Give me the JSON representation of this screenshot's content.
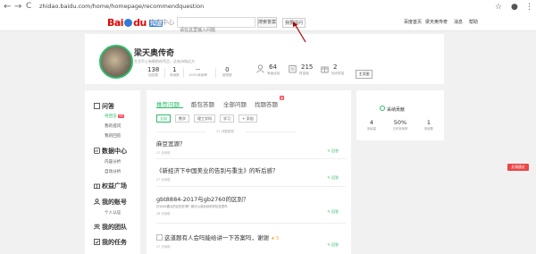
{
  "browser": {
    "back": "←",
    "forward": "→",
    "reload": "C",
    "url": "zhidao.baidu.com/home/homepage/recommendquestion",
    "star": "☆",
    "account": "●",
    "menu": "⋮"
  },
  "topbar": {
    "logo_text_1": "Bai",
    "logo_text_2": "du",
    "logo_zd": "知道",
    "center_label": "个人中心",
    "search_placeholder": "请在这里输入问题",
    "search_button": "搜索答案",
    "ask_button": "我要提问",
    "links": [
      "百度首页",
      "梁天奥传奇",
      "消息",
      "帮助"
    ]
  },
  "profile": {
    "name": "梁天奥传奇",
    "signature": "生活不止有眼前的苟且，还有诗和远方",
    "stats": [
      {
        "value": "138",
        "label": "回答数"
      },
      {
        "value": "1",
        "label": "采纳数"
      },
      {
        "value": "--",
        "label": "100%采纳率"
      },
      {
        "value": "0",
        "label": "被赞数"
      }
    ],
    "right_stats": [
      {
        "value": "64",
        "label": "等级经验",
        "icon": "user-icon"
      },
      {
        "value": "215",
        "label": "财富值",
        "icon": "wallet-icon"
      },
      {
        "value": "2",
        "label": "知识财富",
        "icon": "gift-icon"
      }
    ],
    "home_button": "主页图"
  },
  "sidebar": {
    "sections": [
      {
        "title": "问答",
        "icon": "qa-icon",
        "items": [
          "待回答",
          "我的提问",
          "我的回答"
        ]
      },
      {
        "title": "数据中心",
        "icon": "data-icon",
        "items": [
          "内容分析",
          "自动分析"
        ]
      },
      {
        "title": "权益广场",
        "icon": "gift-icon",
        "items": []
      },
      {
        "title": "我的账号",
        "icon": "account-icon",
        "items": [
          "个人认证"
        ]
      },
      {
        "title": "我的团队",
        "icon": "team-icon",
        "items": []
      },
      {
        "title": "我的任务",
        "icon": "task-icon",
        "items": []
      }
    ],
    "badge": "99"
  },
  "main": {
    "tabs": [
      "推荐问题",
      "酷包答题",
      "全部问题",
      "找题答题"
    ],
    "tab_badge": "新",
    "filters": [
      "全部",
      "数学",
      "理工学科",
      "学习",
      "+ 添加"
    ],
    "update_tip": "27 问题更新",
    "questions": [
      {
        "title": "麻豆宽源？",
        "desc": "",
        "meta": "27 分钟前",
        "answer": "回答"
      },
      {
        "title": "《新经济下中国美业的告别与重生》的听后感？",
        "desc": "",
        "meta": "27 分钟前",
        "answer": "回答"
      },
      {
        "title": "gbt8884-2017与gb2760的区别？",
        "desc": "针对GB要点的区别在哪？都可以添加到和学检查里吗",
        "meta": "28 分钟前",
        "answer": "回答"
      },
      {
        "title": "这道题有人会吗能给讲一下答案吗，谢谢",
        "desc": "",
        "meta": "27 分钟前",
        "answer": "回答"
      }
    ]
  },
  "right_panel": {
    "title": "采纳贡献",
    "stats": [
      {
        "value": "4",
        "label": "采纳量"
      },
      {
        "value": "50%",
        "label": "日均采纳率"
      },
      {
        "value": "1",
        "label": "采纳数"
      }
    ]
  },
  "feedback_label": "反馈建议",
  "colors": {
    "accent": "#2fbd6b",
    "baidu_red": "#e10601",
    "baidu_blue": "#2d7bd8",
    "badge": "#ff4455"
  }
}
